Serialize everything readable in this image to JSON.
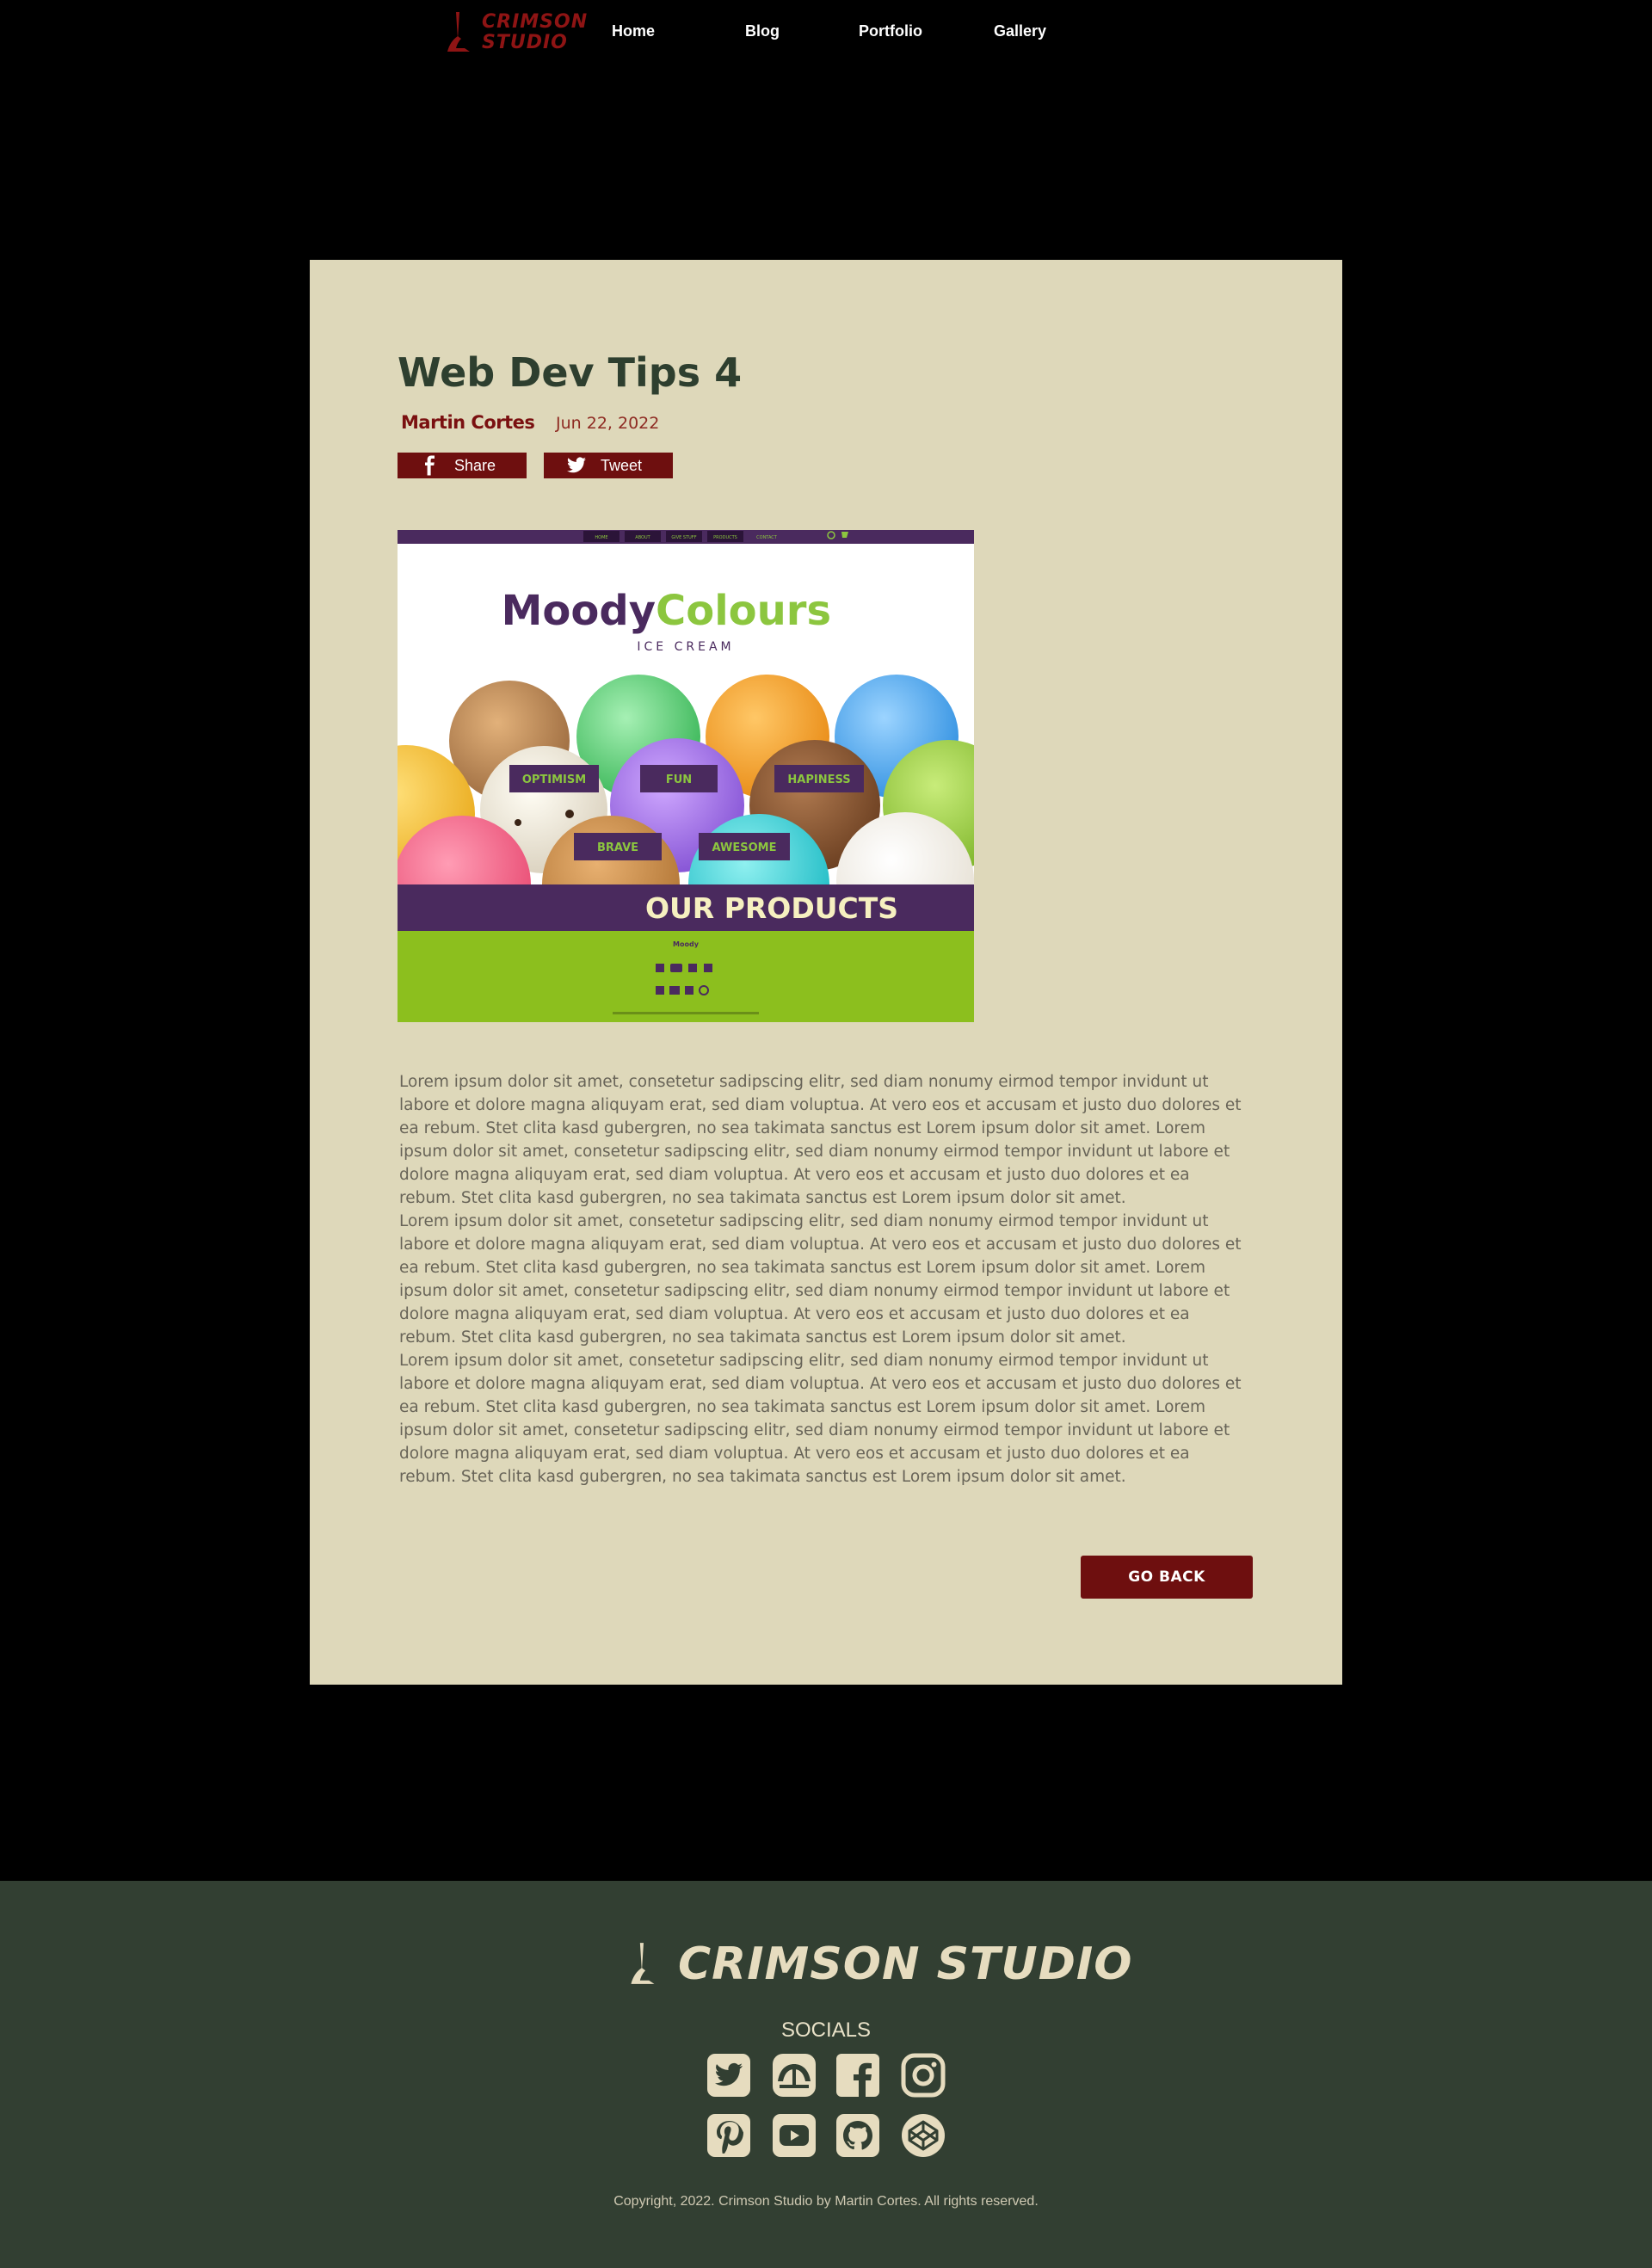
{
  "header": {
    "brand_line1": "CRIMSON",
    "brand_line2": "STUDIO",
    "nav": [
      "Home",
      "Blog",
      "Portfolio",
      "Gallery"
    ]
  },
  "post": {
    "title": "Web Dev Tips 4",
    "author": "Martin Cortes",
    "date": "Jun 22, 2022",
    "share_label": "Share",
    "tweet_label": "Tweet",
    "paragraphs": [
      "Lorem ipsum dolor sit amet, consetetur sadipscing elitr, sed diam nonumy eirmod tempor invidunt ut labore et dolore magna aliquyam erat, sed diam voluptua. At vero eos et accusam et justo duo dolores et ea rebum. Stet clita kasd gubergren, no sea takimata sanctus est Lorem ipsum dolor sit amet. Lorem ipsum dolor sit amet, consetetur sadipscing elitr, sed diam nonumy eirmod tempor invidunt ut labore et dolore magna aliquyam erat, sed diam voluptua. At vero eos et accusam et justo duo dolores et ea rebum. Stet clita kasd gubergren, no sea takimata sanctus est Lorem ipsum dolor sit amet.",
      "Lorem ipsum dolor sit amet, consetetur sadipscing elitr, sed diam nonumy eirmod tempor invidunt ut labore et dolore magna aliquyam erat, sed diam voluptua. At vero eos et accusam et justo duo dolores et ea rebum. Stet clita kasd gubergren, no sea takimata sanctus est Lorem ipsum dolor sit amet. Lorem ipsum dolor sit amet, consetetur sadipscing elitr, sed diam nonumy eirmod tempor invidunt ut labore et dolore magna aliquyam erat, sed diam voluptua. At vero eos et accusam et justo duo dolores et ea rebum. Stet clita kasd gubergren, no sea takimata sanctus est Lorem ipsum dolor sit amet.",
      "Lorem ipsum dolor sit amet, consetetur sadipscing elitr, sed diam nonumy eirmod tempor invidunt ut labore et dolore magna aliquyam erat, sed diam voluptua. At vero eos et accusam et justo duo dolores et ea rebum. Stet clita kasd gubergren, no sea takimata sanctus est Lorem ipsum dolor sit amet. Lorem ipsum dolor sit amet, consetetur sadipscing elitr, sed diam nonumy eirmod tempor invidunt ut labore et dolore magna aliquyam erat, sed diam voluptua. At vero eos et accusam et justo duo dolores et ea rebum. Stet clita kasd gubergren, no sea takimata sanctus est Lorem ipsum dolor sit amet."
    ],
    "go_back_label": "GO BACK"
  },
  "thumbnail": {
    "logo_part1": "Moody",
    "logo_part2": "Colours",
    "subtitle": "ICE CREAM",
    "nav": [
      "HOME",
      "ABOUT",
      "GIVE STUFF",
      "PRODUCTS",
      "CONTACT"
    ],
    "tags": [
      "OPTIMISM",
      "FUN",
      "HAPINESS",
      "BRAVE",
      "AWESOME"
    ],
    "banner": "OUR PRODUCTS"
  },
  "footer": {
    "brand": "CRIMSON STUDIO",
    "socials_title": "SOCIALS",
    "socials": [
      "twitter-icon",
      "tabletop-icon",
      "facebook-icon",
      "instagram-icon",
      "pinterest-icon",
      "youtube-icon",
      "github-icon",
      "codepen-icon"
    ],
    "copyright": "Copyright, 2022. Crimson Studio by Martin Cortes. All rights reserved."
  },
  "colors": {
    "page_bg": "#000000",
    "card_bg": "#ded8ba",
    "crimson": "#6e0f0f",
    "footer_bg": "#323f32",
    "title": "#2e3f2f",
    "footer_cream": "#e6dcbf"
  }
}
